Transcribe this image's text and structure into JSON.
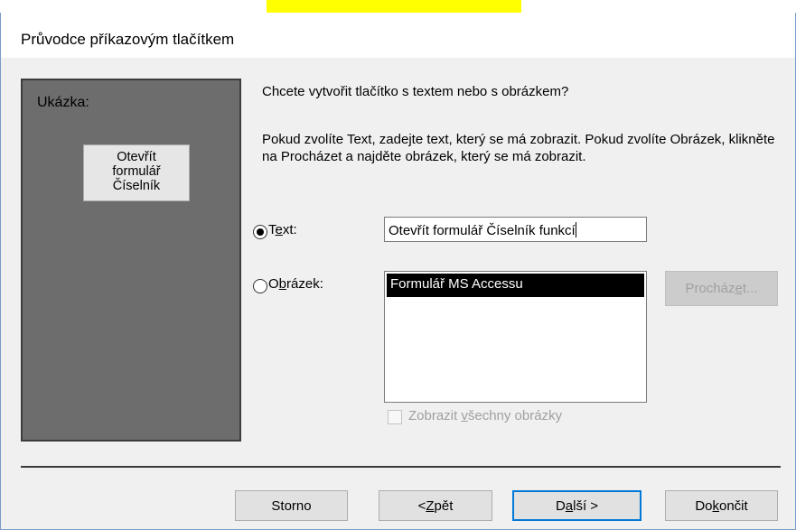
{
  "window": {
    "title": "Průvodce příkazovým tlačítkem"
  },
  "preview": {
    "label": "Ukázka:",
    "button_lines": [
      "Otevřít",
      "formulář",
      "Číselník"
    ]
  },
  "main": {
    "question": "Chcete vytvořit tlačítko s textem nebo s obrázkem?",
    "description": "Pokud zvolíte Text, zadejte text, který se má zobrazit. Pokud zvolíte Obrázek, klikněte na Procházet a najděte obrázek, který se má zobrazit."
  },
  "options": {
    "text_label_pre": "T",
    "text_label_key": "e",
    "text_label_post": "xt:",
    "text_value": "Otevřít formulář Číselník funkcí",
    "text_selected": true,
    "image_label_pre": "O",
    "image_label_key": "b",
    "image_label_post": "rázek:",
    "image_selected": false,
    "image_list": [
      "Formulář MS Accessu"
    ],
    "browse_pre": "Procház",
    "browse_key": "e",
    "browse_post": "t...",
    "show_all_pre": "Zobrazit ",
    "show_all_key": "v",
    "show_all_post": "šechny obrázky",
    "show_all_checked": false
  },
  "buttons": {
    "cancel": "Storno",
    "back_pre": "< ",
    "back_key": "Z",
    "back_post": "pět",
    "next_pre": "D",
    "next_key": "a",
    "next_post": "lší >",
    "finish_pre": "Do",
    "finish_key": "k",
    "finish_post": "ončit"
  },
  "colors": {
    "accent": "#0078d7",
    "preview_bg": "#6d6d6d",
    "highlight": "#ffff00"
  }
}
